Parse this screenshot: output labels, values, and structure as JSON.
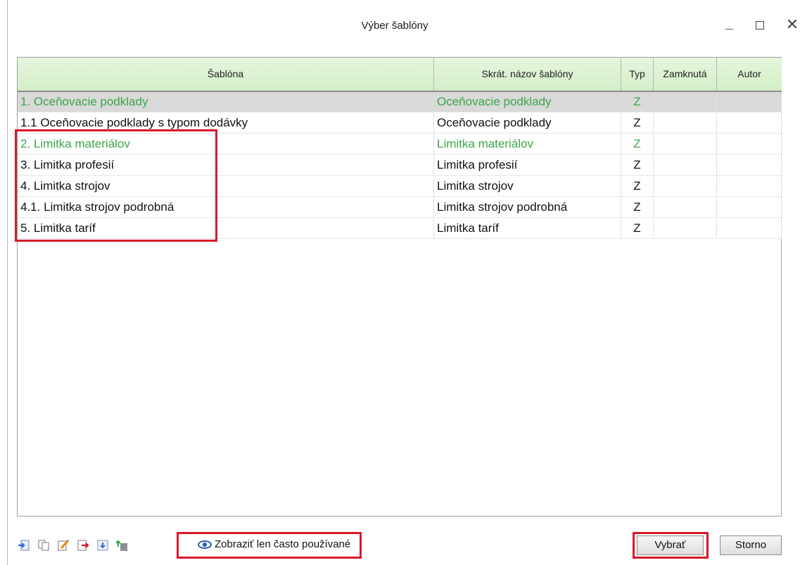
{
  "window": {
    "title": "Výber šablóny"
  },
  "grid": {
    "headers": [
      "Šablóna",
      "Skrát. názov šablóny",
      "Typ",
      "Zamknutá",
      "Autor"
    ],
    "rows": [
      {
        "name": "1. Oceňovacie podklady",
        "short": "Oceňovacie podklady",
        "type": "Z",
        "locked": "",
        "author": ""
      },
      {
        "name": "1.1 Oceňovacie podklady s typom dodávky",
        "short": "Oceňovacie podklady",
        "type": "Z",
        "locked": "",
        "author": ""
      },
      {
        "name": "2. Limitka materiálov",
        "short": "Limitka materiálov",
        "type": "Z",
        "locked": "",
        "author": ""
      },
      {
        "name": "3. Limitka profesií",
        "short": "Limitka profesií",
        "type": "Z",
        "locked": "",
        "author": ""
      },
      {
        "name": "4. Limitka strojov",
        "short": "Limitka strojov",
        "type": "Z",
        "locked": "",
        "author": ""
      },
      {
        "name": "4.1. Limitka strojov podrobná",
        "short": "Limitka strojov podrobná",
        "type": "Z",
        "locked": "",
        "author": ""
      },
      {
        "name": "5. Limitka taríf",
        "short": "Limitka taríf",
        "type": "Z",
        "locked": "",
        "author": ""
      }
    ]
  },
  "footer": {
    "show_frequent_label": "Zobraziť len často používané",
    "select_label": "Vybrať",
    "cancel_label": "Storno"
  },
  "colors": {
    "header_bg": "#d3eec8",
    "group_text": "#3aa64a",
    "highlight": "#d7192a",
    "selected_row": "#d9d9d9"
  }
}
